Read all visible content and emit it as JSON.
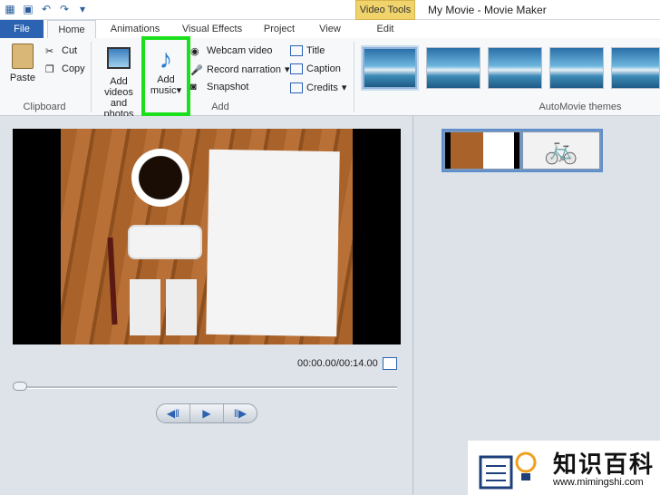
{
  "window": {
    "title": "My Movie - Movie Maker",
    "context_tab": "Video Tools"
  },
  "tabs": {
    "file": "File",
    "home": "Home",
    "animations": "Animations",
    "visual_effects": "Visual Effects",
    "project": "Project",
    "view": "View",
    "edit": "Edit"
  },
  "clipboard": {
    "paste": "Paste",
    "cut": "Cut",
    "copy": "Copy",
    "group": "Clipboard"
  },
  "add": {
    "add_videos_line1": "Add videos",
    "add_videos_line2": "and photos",
    "add_music_line1": "Add",
    "add_music_line2": "music",
    "webcam": "Webcam video",
    "record": "Record narration",
    "snapshot": "Snapshot",
    "title": "Title",
    "caption": "Caption",
    "credits": "Credits",
    "group": "Add"
  },
  "themes": {
    "group": "AutoMovie themes"
  },
  "player": {
    "time": "00:00.00/00:14.00"
  },
  "watermark": {
    "name": "知识百科",
    "url": "www.mimingshi.com"
  },
  "colors": {
    "accent": "#2b63b2",
    "highlight": "#19e01b",
    "context": "#f0d36b"
  }
}
